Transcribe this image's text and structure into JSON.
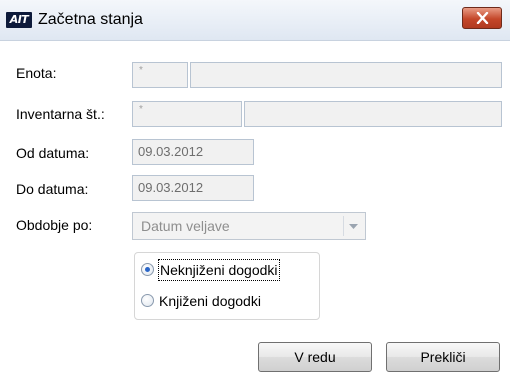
{
  "window": {
    "logo_text": "AIT",
    "title": "Začetna stanja"
  },
  "form": {
    "enota": {
      "label": "Enota:",
      "code": "*",
      "name": ""
    },
    "inventarna": {
      "label": "Inventarna št.:",
      "code": "*",
      "name": ""
    },
    "od_datuma": {
      "label": "Od datuma:",
      "value": "09.03.2012"
    },
    "do_datuma": {
      "label": "Do datuma:",
      "value": "09.03.2012"
    },
    "obdobje": {
      "label": "Obdobje po:",
      "selected": "Datum veljave"
    }
  },
  "options": {
    "items": [
      {
        "label": "Neknjiženi dogodki",
        "checked": true
      },
      {
        "label": "Knjiženi dogodki",
        "checked": false
      }
    ]
  },
  "buttons": {
    "ok": "V redu",
    "cancel": "Prekliči"
  },
  "colors": {
    "close_button": "#c4472a",
    "radio_selected": "#2a66c8",
    "field_border": "#b8c4d2"
  }
}
